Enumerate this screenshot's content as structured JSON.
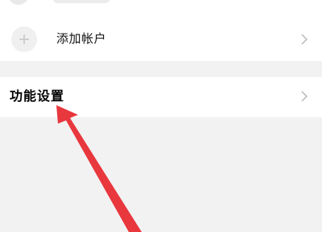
{
  "list": {
    "add_account": {
      "label": "添加帐户",
      "icon": "plus-icon"
    },
    "function_settings": {
      "label": "功能设置"
    },
    "chevron_icon": "chevron-right-icon"
  },
  "annotation": {
    "arrow_color": "#e8373d"
  },
  "colors": {
    "background": "#f2f2f2",
    "card": "#ffffff",
    "chevron": "#b8b8b8"
  }
}
